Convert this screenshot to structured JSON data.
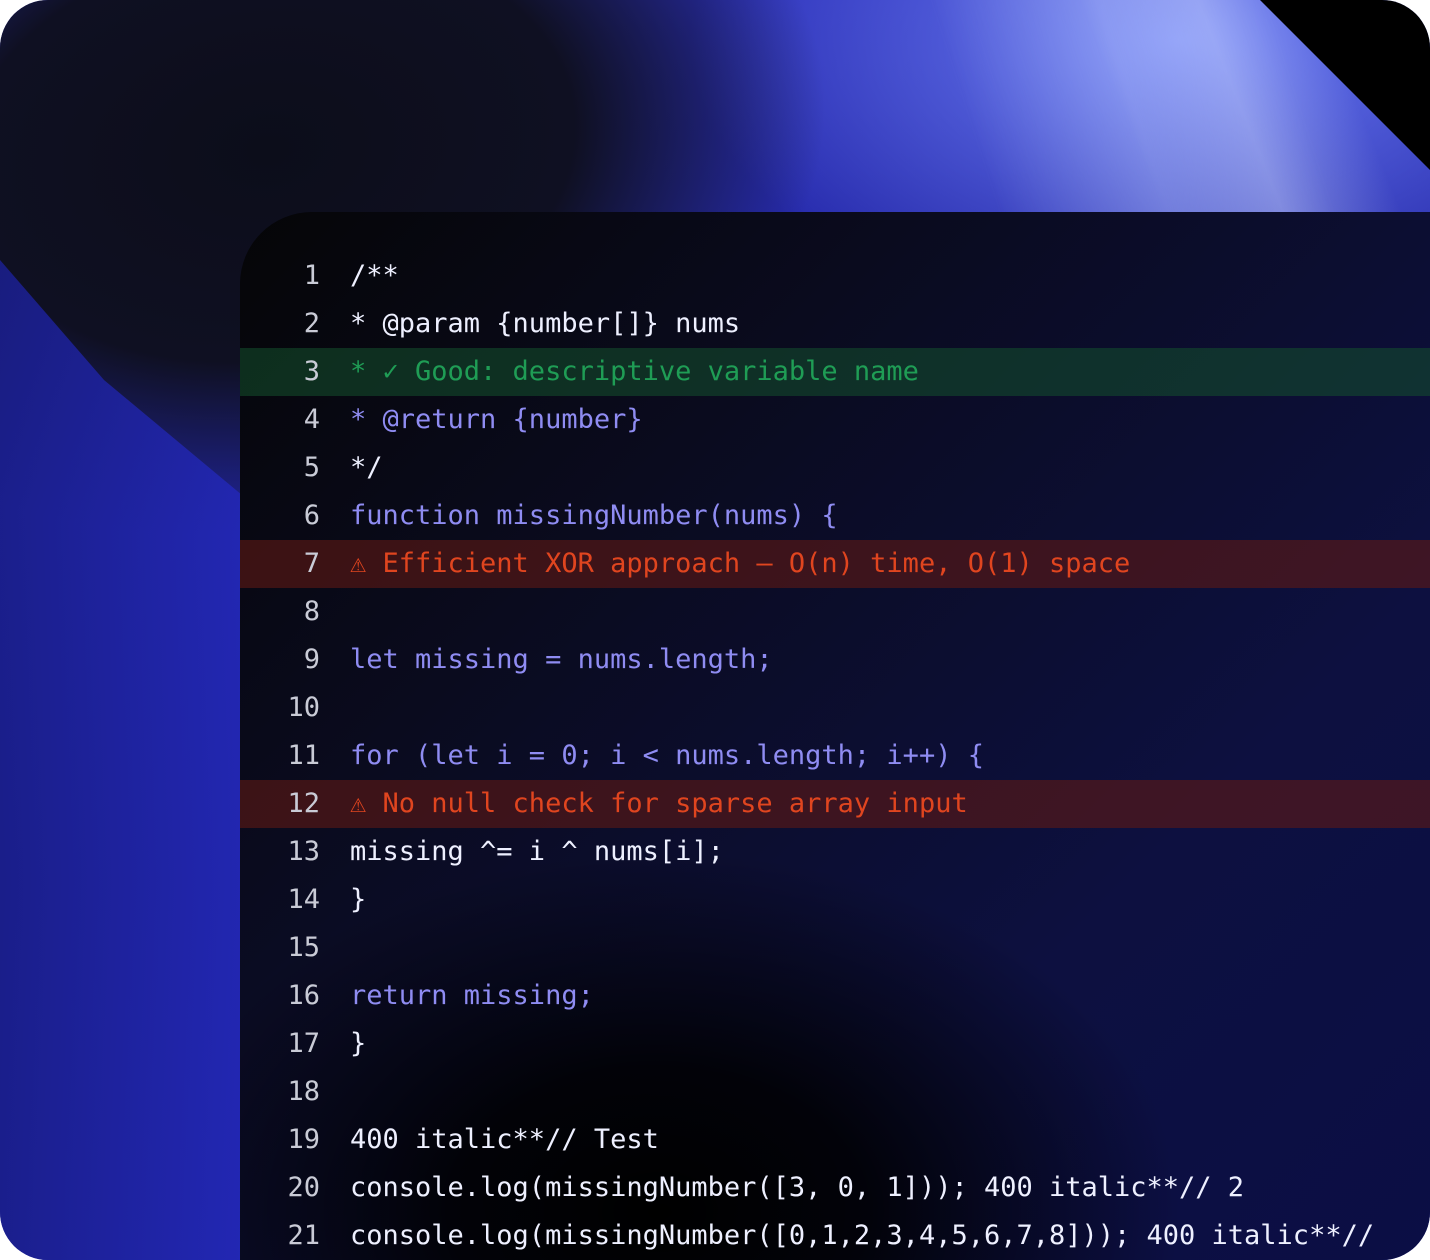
{
  "editor": {
    "lines": [
      {
        "num": "1",
        "text": "/**",
        "kind": "normal",
        "color": "#eef0ff"
      },
      {
        "num": "2",
        "text": "* @param {number[]} nums",
        "kind": "normal",
        "color": "#eef0ff"
      },
      {
        "num": "3",
        "text": "* ✓ Good: descriptive variable name",
        "kind": "good",
        "color": "#1f9d55"
      },
      {
        "num": "4",
        "text": "* @return {number}",
        "kind": "normal",
        "color": "#8f8cf2"
      },
      {
        "num": "5",
        "text": "*/",
        "kind": "normal",
        "color": "#eef0ff"
      },
      {
        "num": "6",
        "text": "function missingNumber(nums) {",
        "kind": "normal",
        "color": "#8f8cf2"
      },
      {
        "num": "7",
        "text": "⚠ Efficient XOR approach — O(n) time, O(1) space",
        "kind": "warn",
        "color": "#e0451f"
      },
      {
        "num": "8",
        "text": "",
        "kind": "normal",
        "color": "#eef0ff"
      },
      {
        "num": "9",
        "text": "let missing = nums.length;",
        "kind": "normal",
        "color": "#8f8cf2"
      },
      {
        "num": "10",
        "text": "",
        "kind": "normal",
        "color": "#eef0ff"
      },
      {
        "num": "11",
        "text": "for (let i = 0; i < nums.length; i++) {",
        "kind": "normal",
        "color": "#8f8cf2"
      },
      {
        "num": "12",
        "text": "⚠ No null check for sparse array input",
        "kind": "warn",
        "color": "#e0451f"
      },
      {
        "num": "13",
        "text": "missing ^= i ^ nums[i];",
        "kind": "normal",
        "color": "#eef0ff"
      },
      {
        "num": "14",
        "text": "}",
        "kind": "normal",
        "color": "#eef0ff"
      },
      {
        "num": "15",
        "text": "",
        "kind": "normal",
        "color": "#eef0ff"
      },
      {
        "num": "16",
        "text": "return missing;",
        "kind": "normal",
        "color": "#8f8cf2"
      },
      {
        "num": "17",
        "text": "}",
        "kind": "normal",
        "color": "#eef0ff"
      },
      {
        "num": "18",
        "text": "",
        "kind": "normal",
        "color": "#eef0ff"
      },
      {
        "num": "19",
        "text": "400 italic**// Test",
        "kind": "normal",
        "color": "#eef0ff"
      },
      {
        "num": "20",
        "text": "console.log(missingNumber([3, 0, 1])); 400 italic**// 2",
        "kind": "normal",
        "color": "#eef0ff"
      },
      {
        "num": "21",
        "text": "console.log(missingNumber([0,1,2,3,4,5,6,7,8])); 400 italic**//",
        "kind": "normal",
        "color": "#eef0ff"
      }
    ]
  },
  "colors": {
    "good_highlight": "#14502d",
    "warn_highlight": "#5f1914",
    "accent_purple": "#8f8cf2",
    "good_green": "#1f9d55",
    "warn_red": "#e0451f"
  }
}
